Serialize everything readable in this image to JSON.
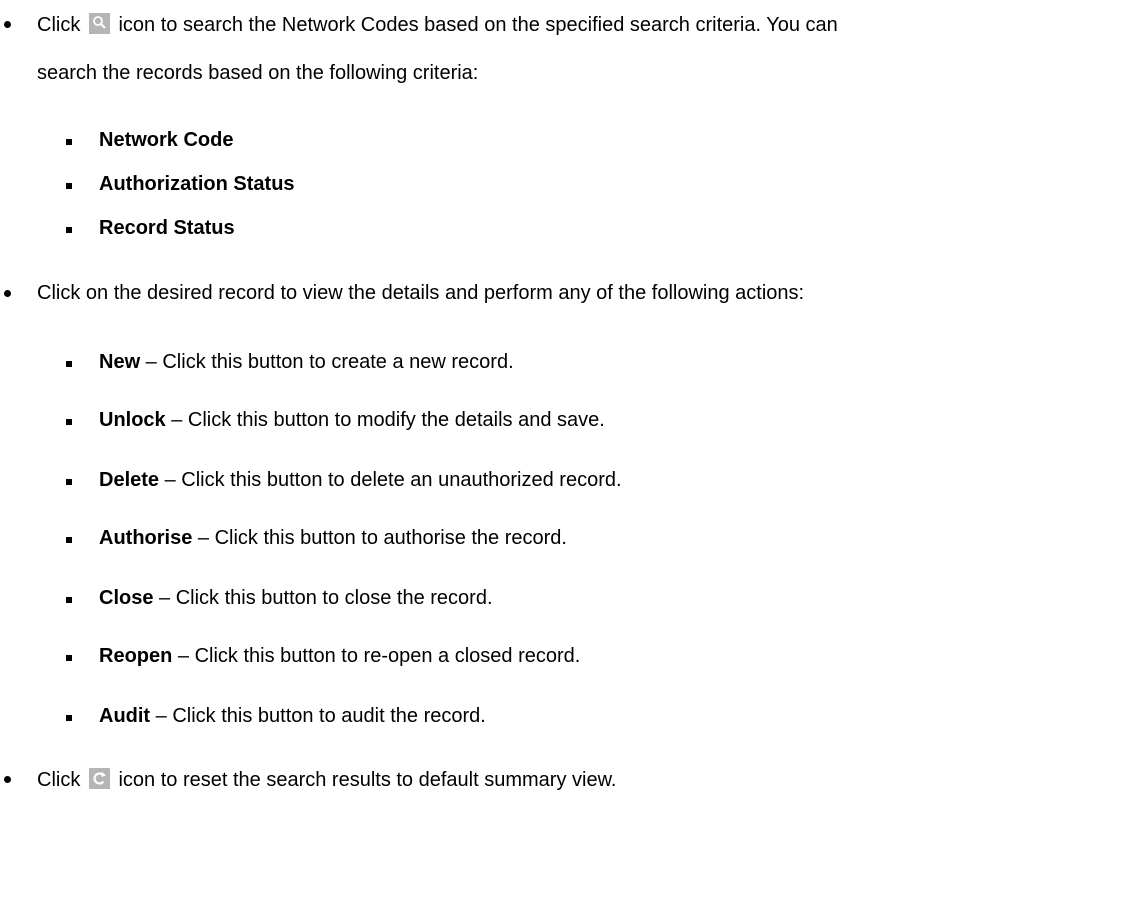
{
  "intro": {
    "click_prefix": "Click",
    "search_line1_after_icon": "icon to search the Network Codes based on the specified search criteria. You can",
    "search_line2": "search the records based on the following criteria:",
    "search_icon": "search-icon"
  },
  "criteria": [
    {
      "label": "Network Code"
    },
    {
      "label": "Authorization Status"
    },
    {
      "label": "Record Status"
    }
  ],
  "record_click": "Click on the desired record to view the details and perform any of the following actions:",
  "actions": [
    {
      "name": "New",
      "desc": " – Click this button to create a new record."
    },
    {
      "name": "Unlock",
      "desc": " – Click this button to modify the details and save."
    },
    {
      "name": "Delete",
      "desc": " – Click this button to delete an unauthorized record."
    },
    {
      "name": "Authorise",
      "desc": " – Click this button to authorise the record."
    },
    {
      "name": "Close",
      "desc": " – Click this button to close the record."
    },
    {
      "name": "Reopen",
      "desc": " – Click this button to re-open a closed record."
    },
    {
      "name": "Audit",
      "desc": " – Click this button to audit the record."
    }
  ],
  "reset": {
    "click_prefix": "Click",
    "after_icon": "icon to reset the search results to default summary view.",
    "reset_icon": "reset-icon"
  }
}
